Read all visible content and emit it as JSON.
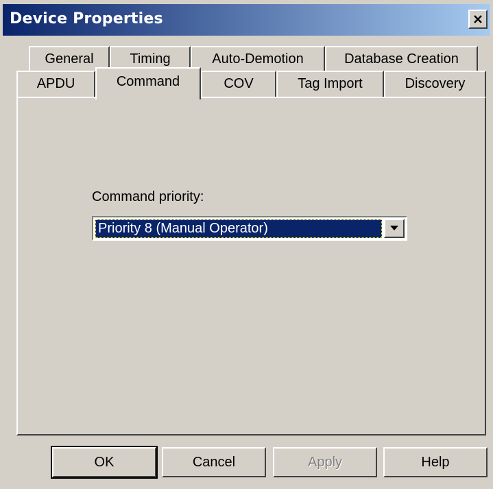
{
  "window": {
    "title": "Device Properties",
    "close_icon": "close-icon"
  },
  "tabs": {
    "row1": [
      "General",
      "Timing",
      "Auto-Demotion",
      "Database Creation"
    ],
    "row2": [
      "APDU",
      "Command",
      "COV",
      "Tag Import",
      "Discovery"
    ],
    "active": "Command"
  },
  "command": {
    "priority_label": "Command priority:",
    "priority_value": "Priority 8 (Manual Operator)",
    "dropdown_icon": "chevron-down-icon"
  },
  "buttons": {
    "ok": "OK",
    "cancel": "Cancel",
    "apply": "Apply",
    "help": "Help"
  },
  "colors": {
    "titlebar_start": "#0a246a",
    "titlebar_end": "#a6caf0",
    "face": "#d4d0c8",
    "selection": "#0a246a"
  }
}
